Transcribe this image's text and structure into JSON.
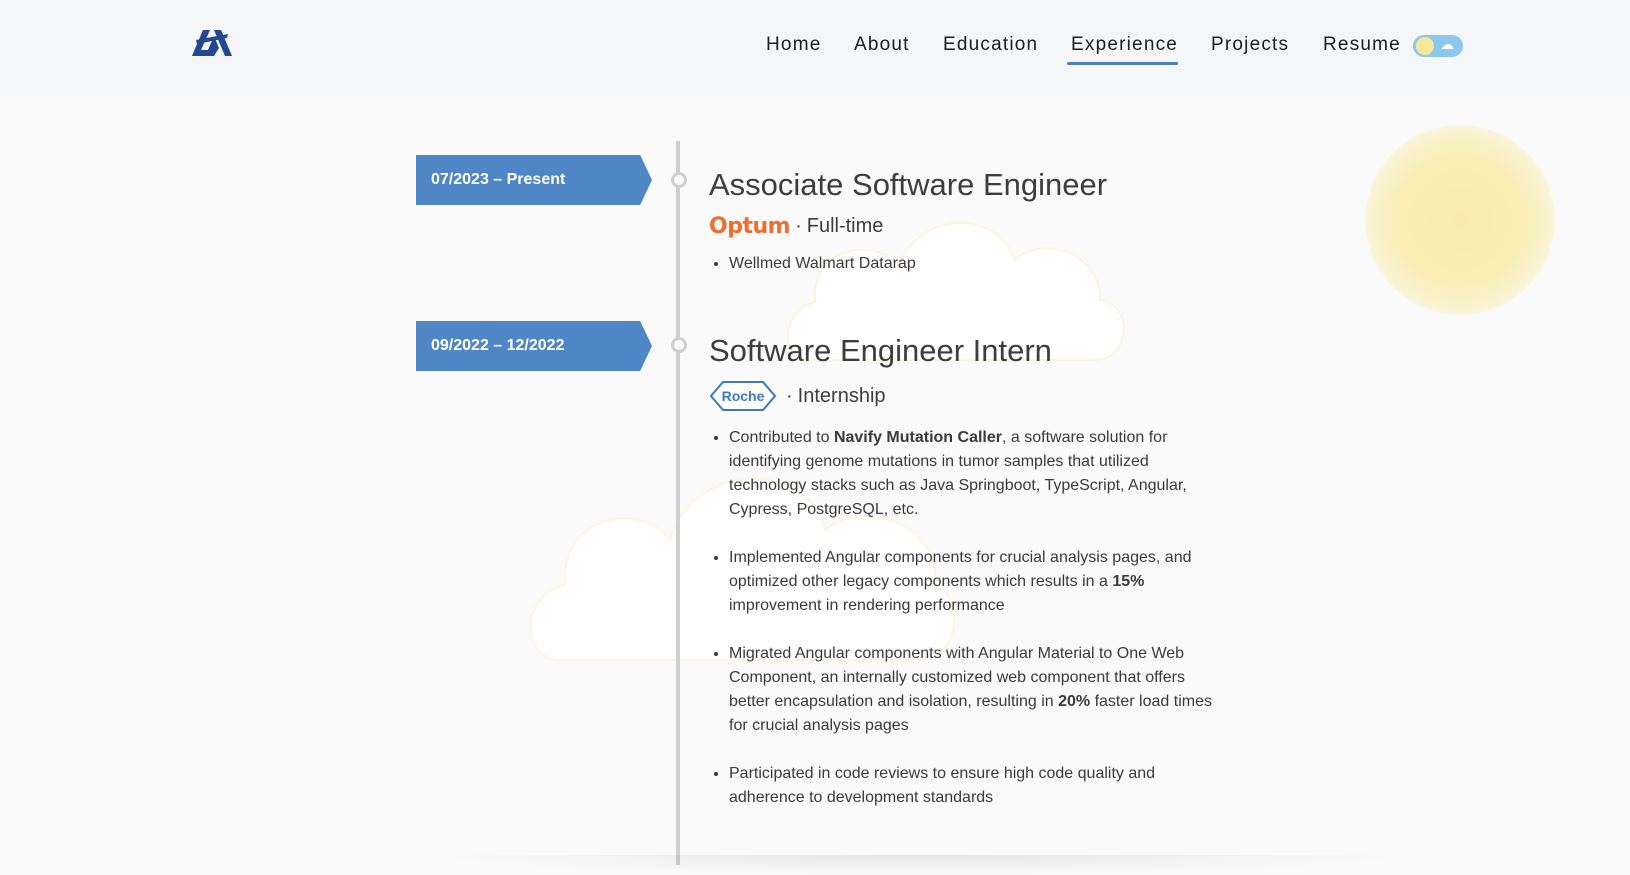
{
  "nav": {
    "logo_icon": "monogram-logo-icon",
    "items": [
      {
        "label": "Home"
      },
      {
        "label": "About"
      },
      {
        "label": "Education"
      },
      {
        "label": "Experience",
        "active": true
      },
      {
        "label": "Projects"
      },
      {
        "label": "Resume"
      }
    ],
    "theme_toggle": {
      "state": "light",
      "icons": [
        "sun-icon",
        "cloud-icon"
      ]
    }
  },
  "colors": {
    "accent": "#4f86c6",
    "nav_underline": "#4b7fc0",
    "optum": "#f26b2f",
    "roche": "#3a78c3",
    "timeline": "#cfcfcf",
    "sun": "#f9ebad"
  },
  "experience": [
    {
      "date": "07/2023 – Present",
      "title": "Associate Software Engineer",
      "company_logo": "optum-logo",
      "company_text": "Optum",
      "separator": "·",
      "employment_type": "Full-time",
      "bullets": [
        [
          {
            "t": "Wellmed Walmart Datarap"
          }
        ]
      ]
    },
    {
      "date": "09/2022 – 12/2022",
      "title": "Software Engineer Intern",
      "company_logo": "roche-logo",
      "company_text": "Roche",
      "separator": "·",
      "employment_type": "Internship",
      "bullets": [
        [
          {
            "t": "Contributed to "
          },
          {
            "t": "Navify Mutation Caller",
            "b": true
          },
          {
            "t": ", a software solution for identifying genome mutations in tumor samples that utilized technology stacks such as Java Springboot, TypeScript, Angular, Cypress, PostgreSQL, etc."
          }
        ],
        [
          {
            "t": "Implemented Angular components for crucial analysis pages, and optimized other legacy components which results in a "
          },
          {
            "t": "15%",
            "b": true
          },
          {
            "t": " improvement in rendering performance"
          }
        ],
        [
          {
            "t": "Migrated Angular components with Angular Material to One Web Component, an internally customized web component that offers better encapsulation and isolation, resulting in "
          },
          {
            "t": "20%",
            "b": true
          },
          {
            "t": " faster load times for crucial analysis pages"
          }
        ],
        [
          {
            "t": "Participated in code reviews to ensure high code quality and adherence to development standards"
          }
        ]
      ]
    }
  ]
}
